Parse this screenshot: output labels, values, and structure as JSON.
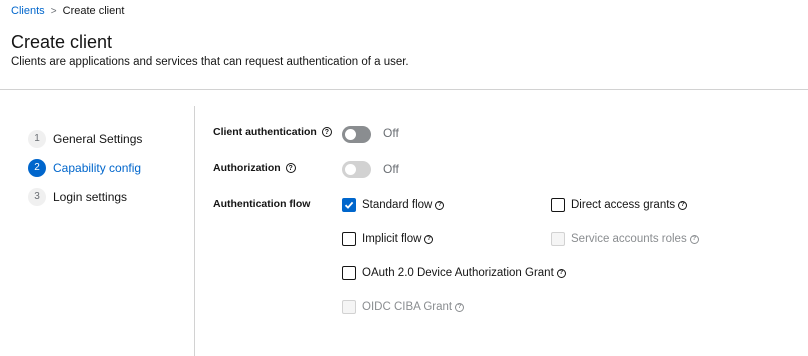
{
  "breadcrumb": {
    "parent": "Clients",
    "separator": ">",
    "current": "Create client"
  },
  "page": {
    "title": "Create client",
    "subtitle": "Clients are applications and services that can request authentication of a user."
  },
  "wizard": {
    "steps": [
      {
        "number": "1",
        "label": "General Settings",
        "active": false
      },
      {
        "number": "2",
        "label": "Capability config",
        "active": true
      },
      {
        "number": "3",
        "label": "Login settings",
        "active": false
      }
    ]
  },
  "form": {
    "client_authentication": {
      "label": "Client authentication",
      "state": "Off",
      "enabled": true
    },
    "authorization": {
      "label": "Authorization",
      "state": "Off",
      "enabled": false
    },
    "authentication_flow": {
      "label": "Authentication flow",
      "options": [
        {
          "label": "Standard flow",
          "checked": true,
          "disabled": false
        },
        {
          "label": "Direct access grants",
          "checked": false,
          "disabled": false
        },
        {
          "label": "Implicit flow",
          "checked": false,
          "disabled": false
        },
        {
          "label": "Service accounts roles",
          "checked": false,
          "disabled": true
        },
        {
          "label": "OAuth 2.0 Device Authorization Grant",
          "checked": false,
          "disabled": false
        },
        {
          "label": "OIDC CIBA Grant",
          "checked": false,
          "disabled": true
        }
      ]
    }
  },
  "icons": {
    "help": "help-circle-icon",
    "separator": "chevron-right-icon",
    "check": "check-icon"
  },
  "colors": {
    "accent": "#0066cc",
    "divider": "#d2d2d2",
    "switch_off": "#8a8d90",
    "switch_disabled": "#d2d2d2"
  }
}
